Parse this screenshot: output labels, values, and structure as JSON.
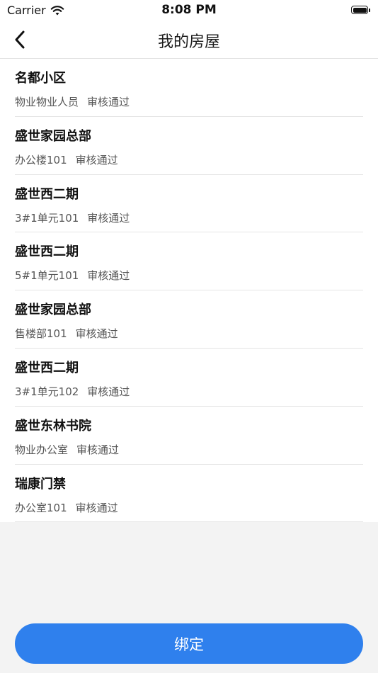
{
  "status_bar": {
    "carrier": "Carrier",
    "time": "8:08 PM"
  },
  "nav": {
    "title": "我的房屋"
  },
  "houses": [
    {
      "name": "名都小区",
      "unit": "物业物业人员",
      "status": "审核通过"
    },
    {
      "name": "盛世家园总部",
      "unit": "办公楼101",
      "status": "审核通过"
    },
    {
      "name": "盛世西二期",
      "unit": "3#1单元101",
      "status": "审核通过"
    },
    {
      "name": "盛世西二期",
      "unit": "5#1单元101",
      "status": "审核通过"
    },
    {
      "name": "盛世家园总部",
      "unit": "售楼部101",
      "status": "审核通过"
    },
    {
      "name": "盛世西二期",
      "unit": "3#1单元102",
      "status": "审核通过"
    },
    {
      "name": "盛世东林书院",
      "unit": "物业办公室",
      "status": "审核通过"
    },
    {
      "name": "瑞康门禁",
      "unit": "办公室101",
      "status": "审核通过"
    }
  ],
  "bind_button": {
    "label": "绑定"
  },
  "colors": {
    "accent": "#2f80ed",
    "background": "#f3f3f3"
  }
}
